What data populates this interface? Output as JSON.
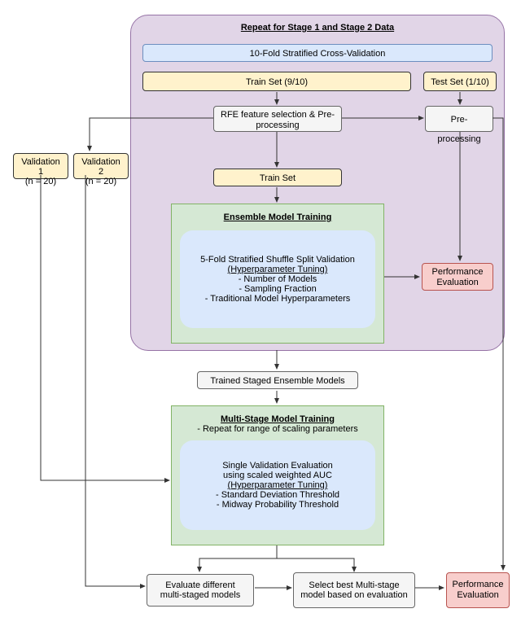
{
  "purple_title": "Repeat for Stage 1 and Stage 2 Data",
  "cv_label": "10-Fold Stratified Cross-Validation",
  "train_set_910": "Train Set (9/10)",
  "test_set_110": "Test Set (1/10)",
  "rfe_label": "RFE feature selection & Pre-processing",
  "preproc_label": "Pre-processing",
  "train_set_label": "Train Set",
  "val1_label": "Validation 1\n(n = 20)",
  "val2_label": "Validation 2\n(n = 20)",
  "ensemble_title": "Ensemble Model Training",
  "ensemble_card_title": "5-Fold Stratified Shuffle Split Validation",
  "ensemble_card_subtitle": "(Hyperparameter Tuning)",
  "ensemble_item1": "- Number of Models",
  "ensemble_item2": "- Sampling Fraction",
  "ensemble_item3": "- Traditional Model Hyperparameters",
  "perf_eval_label": "Performance Evaluation",
  "trained_staged_label": "Trained Staged Ensemble Models",
  "multistage_title": "Multi-Stage Model Training",
  "multistage_sub": "- Repeat for range of scaling parameters",
  "multistage_card_t1": "Single Validation Evaluation",
  "multistage_card_t2": "using scaled weighted AUC",
  "multistage_card_sub": "(Hyperparameter Tuning)",
  "multistage_item1": "- Standard Deviation Threshold",
  "multistage_item2": "- Midway Probability Threshold",
  "eval_diff_label": "Evaluate different multi-staged models",
  "select_best_label": "Select best Multi-stage model based on evaluation"
}
